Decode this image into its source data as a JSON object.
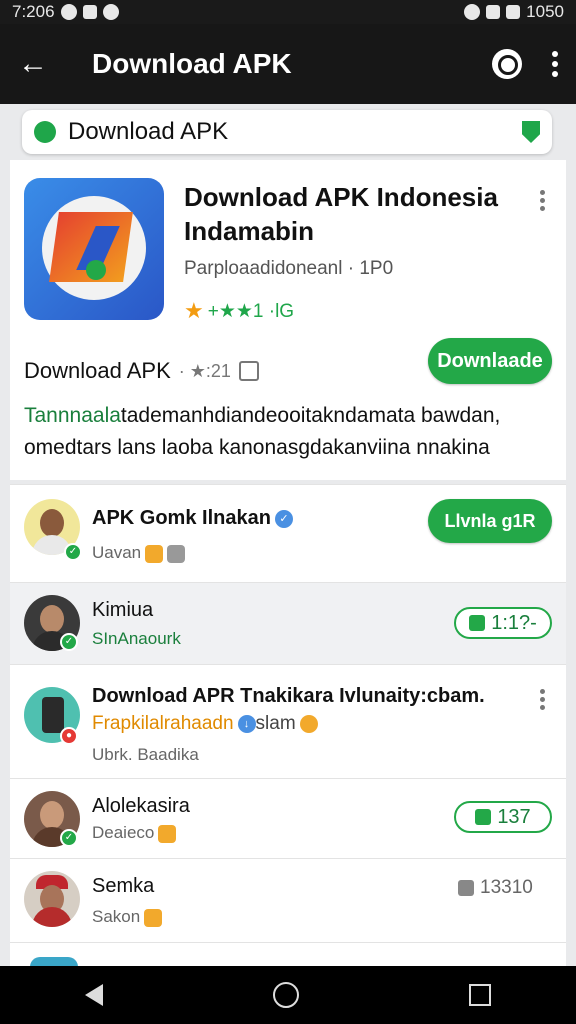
{
  "status_bar": {
    "time": "7:206",
    "battery": "1050"
  },
  "app_bar": {
    "back_icon": "←",
    "title": "Download APK"
  },
  "search_card": {
    "label": "Download APK"
  },
  "main_card": {
    "app_name": "Download APK Indonesia Indamabin",
    "publisher": "Parpl​oaadidoneanl · 1P0",
    "rating_text": "+★★1 ·lG",
    "sub_title": "Download APK",
    "sub_meta": "· ★:21",
    "download_button": "Downlaade",
    "description_accent": "Tannnaala",
    "description_rest": "tademanhdiandeooitakndamata bawdan, omedtars lans laoba kanonasgdakanviina nnakina"
  },
  "list": [
    {
      "title": "APK Gomk Ilnakan",
      "subtitle": "Uavan",
      "action": "Llvnla g1R"
    },
    {
      "title": "Kimiua",
      "subtitle": "SInAnaourk",
      "action": "1:1?-"
    },
    {
      "title": "Download APR Tnakikara Ivlunaity:cbam.",
      "subtitle": "Frapkilalrahaadn",
      "subtitle2": "slam",
      "subtitle3": "Ubrk. Baadika"
    },
    {
      "title": "Alolekasira",
      "subtitle": "Deaieco",
      "action": "137"
    },
    {
      "title": "Semka",
      "subtitle": "Sakon",
      "action": "13310"
    }
  ]
}
